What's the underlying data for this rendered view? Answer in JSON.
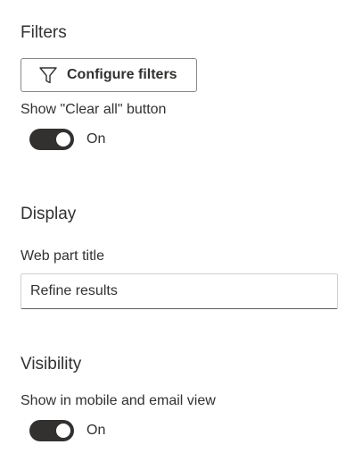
{
  "filters": {
    "heading": "Filters",
    "configure_button_label": "Configure filters",
    "configure_icon": "filter-icon",
    "clear_all_label": "Show \"Clear all\" button",
    "clear_all_toggle_state": "On",
    "clear_all_toggle_on": true
  },
  "display": {
    "heading": "Display",
    "title_field_label": "Web part title",
    "title_field_value": "Refine results"
  },
  "visibility": {
    "heading": "Visibility",
    "mobile_email_label": "Show in mobile and email view",
    "mobile_email_toggle_state": "On",
    "mobile_email_toggle_on": true
  },
  "colors": {
    "text": "#323130",
    "toggle_on": "#323130",
    "border": "#8a8886"
  }
}
